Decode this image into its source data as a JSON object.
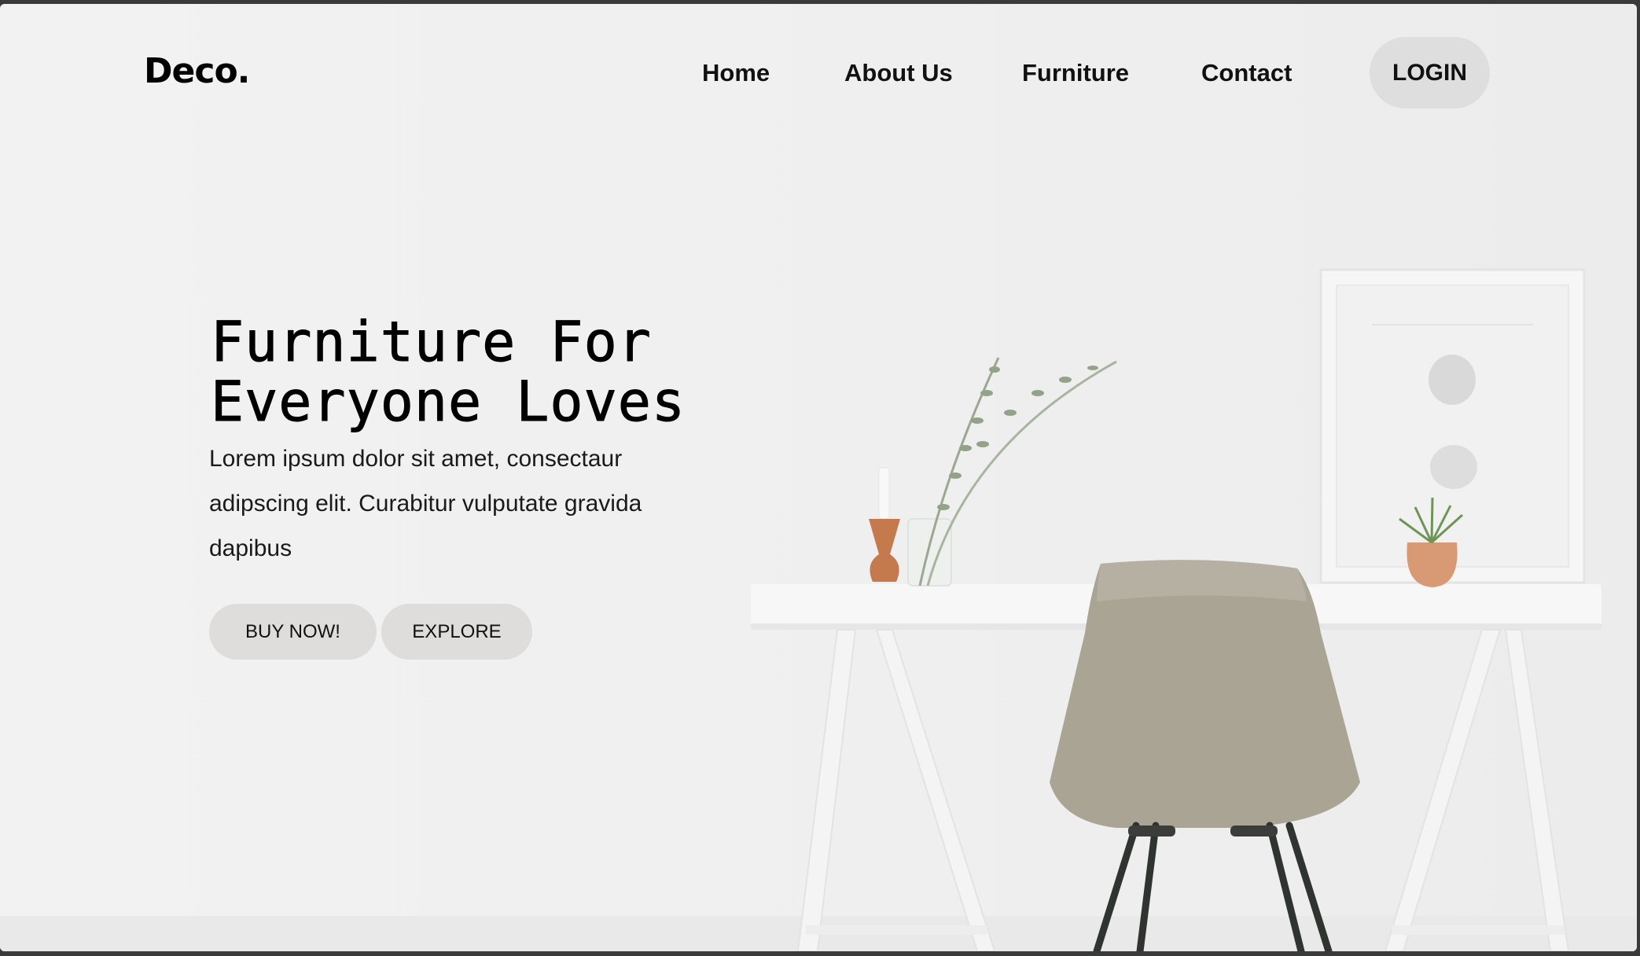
{
  "brand": {
    "logo": "Deco."
  },
  "nav": {
    "items": [
      {
        "label": "Home"
      },
      {
        "label": "About Us"
      },
      {
        "label": "Furniture"
      },
      {
        "label": "Contact"
      }
    ],
    "login_label": "LOGIN"
  },
  "hero": {
    "title_line1": "Furniture For",
    "title_line2": "Everyone Loves",
    "description": "Lorem ipsum dolor sit amet, consectaur adipscing elit. Curabitur vulputate gravida dapibus",
    "buttons": {
      "buy": "BUY NOW!",
      "explore": "EXPLORE"
    }
  },
  "colors": {
    "background": "#efefef",
    "button_bg": "#dedddb",
    "text": "#000000",
    "chair": "#a9a494",
    "vase": "#c47a4c"
  }
}
